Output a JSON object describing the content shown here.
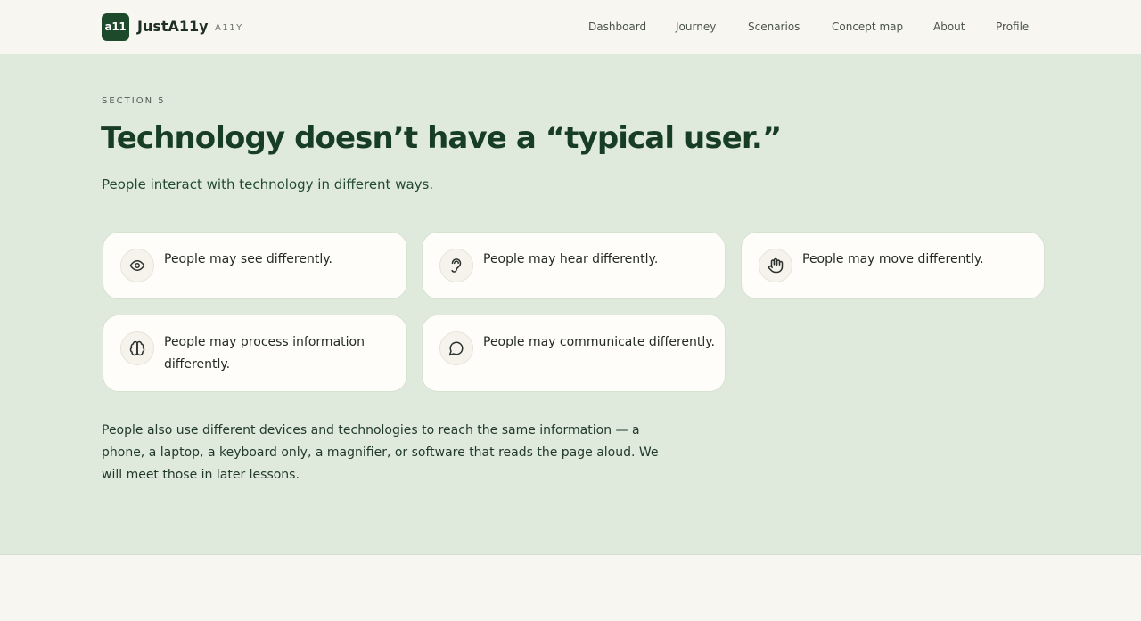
{
  "header": {
    "logo_mark": "a11",
    "brand_name": "JustA11y",
    "brand_tag": "A11Y",
    "nav": [
      {
        "label": "Dashboard"
      },
      {
        "label": "Journey"
      },
      {
        "label": "Scenarios"
      },
      {
        "label": "Concept map"
      },
      {
        "label": "About"
      },
      {
        "label": "Profile"
      }
    ]
  },
  "section": {
    "eyebrow": "SECTION 5",
    "title": "Technology doesn’t have a “typical user.”",
    "subtitle": "People interact with technology in different ways.",
    "cards": [
      {
        "icon": "eye-icon",
        "text": "People may see differently."
      },
      {
        "icon": "ear-icon",
        "text": "People may hear differently."
      },
      {
        "icon": "hand-icon",
        "text": "People may move differently."
      },
      {
        "icon": "brain-icon",
        "text": "People may process information differently."
      },
      {
        "icon": "speech-bubble-icon",
        "text": "People may communicate differently."
      }
    ],
    "note": "People also use different devices and technologies to reach the same information — a phone, a laptop, a keyboard only, a magnifier, or software that reads the page aloud. We will meet those in later lessons."
  },
  "colors": {
    "brand_green": "#1e4a2c",
    "section_background": "#dfeadd",
    "page_background": "#f8f6f1",
    "card_background": "#fefdf9"
  }
}
